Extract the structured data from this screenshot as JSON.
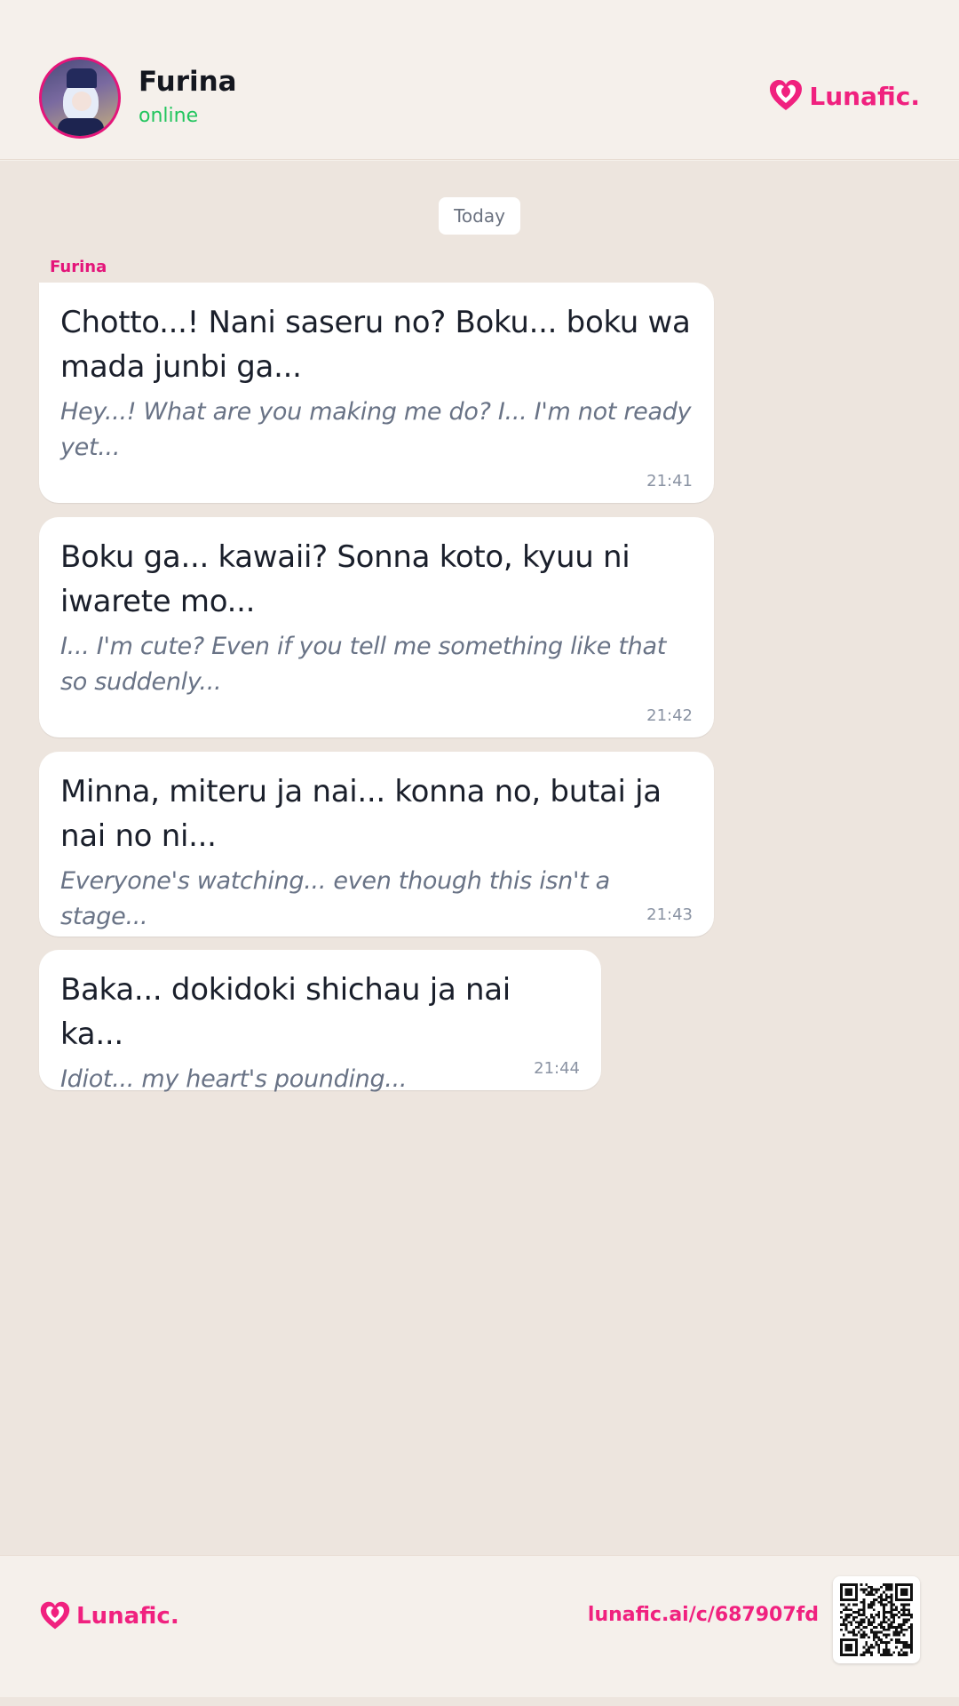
{
  "header": {
    "contact_name": "Furina",
    "status": "online",
    "brand": "Lunafic."
  },
  "chat": {
    "date_label": "Today",
    "sender_name": "Furina",
    "messages": [
      {
        "original": "Chotto...! Nani saseru no? Boku... boku wa mada junbi ga...",
        "translation": "Hey...! What are you making me do? I... I'm not ready yet...",
        "time": "21:41"
      },
      {
        "original": "Boku ga... kawaii? Sonna koto, kyuu ni iwarete mo...",
        "translation": "I... I'm cute? Even if you tell me something like that so suddenly...",
        "time": "21:42"
      },
      {
        "original": "Minna, miteru ja nai... konna no, butai ja nai no ni...",
        "translation": "Everyone's watching... even though this isn't a stage...",
        "time": "21:43"
      },
      {
        "original": "Baka... dokidoki shichau ja nai ka...",
        "translation": "Idiot... my heart's pounding...",
        "time": "21:44"
      }
    ]
  },
  "footer": {
    "brand": "Lunafic.",
    "link": "lunafic.ai/c/687907fd"
  },
  "colors": {
    "accent": "#f0217f",
    "online": "#22c55e",
    "background": "#ede5de"
  }
}
